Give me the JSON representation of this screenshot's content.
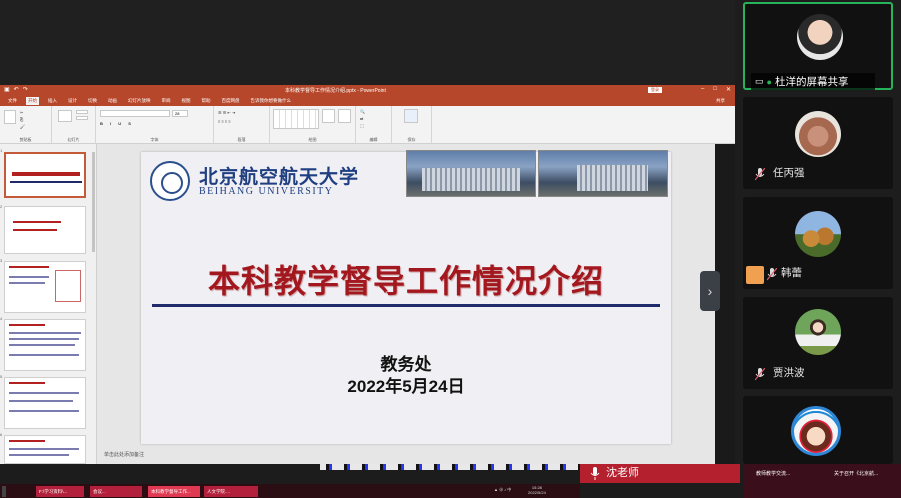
{
  "window": {
    "title": "本科教学督导工作情况介绍.pptx - PowerPoint",
    "login_label": "登录"
  },
  "ribbon": {
    "tabs": [
      "文件",
      "开始",
      "插入",
      "设计",
      "切换",
      "动画",
      "幻灯片放映",
      "审阅",
      "视图",
      "帮助",
      "百度网盘",
      "告诉我你想要做什么"
    ],
    "active_tab": "开始",
    "share_label": "共享",
    "groups": [
      "剪贴板",
      "幻灯片",
      "字体",
      "段落",
      "绘图",
      "编辑",
      "保存"
    ],
    "font_size": "28"
  },
  "thumbnails": {
    "numbers": [
      "1",
      "2",
      "3",
      "4",
      "5",
      "6",
      "7"
    ]
  },
  "slide": {
    "university_cn": "北京航空航天大学",
    "university_en": "BEIHANG UNIVERSITY",
    "title": "本科教学督导工作情况介绍",
    "department": "教务处",
    "date": "2022年5月24日"
  },
  "notes_hint": "单击此处添加备注",
  "meeting": {
    "screen_share_label": "杜洋的屏幕共享",
    "participants": [
      {
        "name": "任丙强"
      },
      {
        "name": "韩蕾"
      },
      {
        "name": "贾洪波"
      },
      {
        "name": ""
      }
    ],
    "current_speaker": "沈老师",
    "accent_color": "#27b35a",
    "muted_color": "#e05a6a"
  },
  "taskbar": {
    "items": [
      "F:\\学习资料\\...",
      "会议...",
      "本科教学督导工作...",
      "人文学院...."
    ],
    "time": "15:28",
    "date": "2022/5/24",
    "right_items": [
      "教师教学交流...",
      "关于召开《北京航..."
    ]
  }
}
